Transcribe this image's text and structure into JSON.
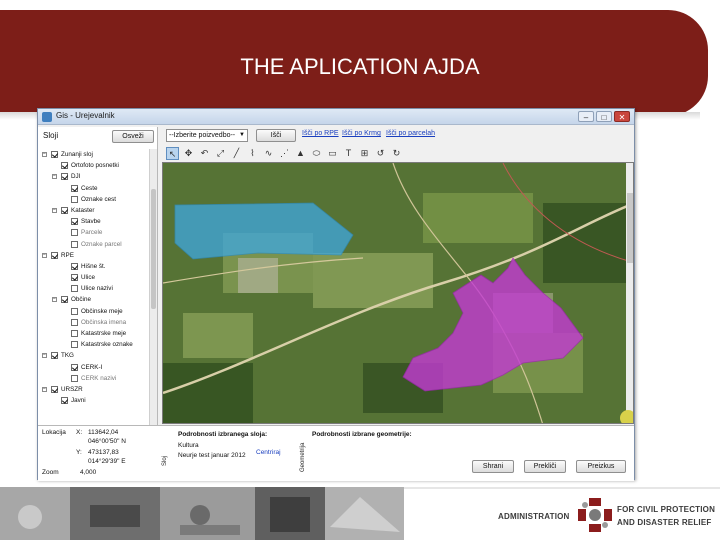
{
  "slide": {
    "title": "THE APLICATION AJDA"
  },
  "window": {
    "title": "Gis - Urejevalnik",
    "minimize": "–",
    "maximize": "□",
    "close": "✕"
  },
  "left_panel": {
    "label": "Sloji",
    "button": "Osveži",
    "tree": [
      {
        "depth": 0,
        "expanded": true,
        "checked": true,
        "label": "Zunanji sloj",
        "dim": false
      },
      {
        "depth": 1,
        "expanded": null,
        "checked": true,
        "label": "Ortofoto posnetki",
        "dim": false
      },
      {
        "depth": 1,
        "expanded": true,
        "checked": true,
        "label": "DJI",
        "dim": false
      },
      {
        "depth": 2,
        "expanded": null,
        "checked": true,
        "label": "Ceste",
        "dim": false
      },
      {
        "depth": 2,
        "expanded": null,
        "checked": false,
        "label": "Oznake cest",
        "dim": false
      },
      {
        "depth": 1,
        "expanded": true,
        "checked": true,
        "label": "Kataster",
        "dim": false
      },
      {
        "depth": 2,
        "expanded": null,
        "checked": true,
        "label": "Stavbe",
        "dim": false
      },
      {
        "depth": 2,
        "expanded": null,
        "checked": false,
        "label": "Parcele",
        "dim": true
      },
      {
        "depth": 2,
        "expanded": null,
        "checked": false,
        "label": "Oznake parcel",
        "dim": true
      },
      {
        "depth": 0,
        "expanded": true,
        "checked": true,
        "label": "RPE",
        "dim": false
      },
      {
        "depth": 2,
        "expanded": null,
        "checked": true,
        "label": "Hišne št.",
        "dim": false
      },
      {
        "depth": 2,
        "expanded": null,
        "checked": true,
        "label": "Ulice",
        "dim": false
      },
      {
        "depth": 2,
        "expanded": null,
        "checked": false,
        "label": "Ulice nazivi",
        "dim": false
      },
      {
        "depth": 1,
        "expanded": true,
        "checked": true,
        "label": "Občine",
        "dim": false
      },
      {
        "depth": 2,
        "expanded": null,
        "checked": false,
        "label": "Občinske meje",
        "dim": false
      },
      {
        "depth": 2,
        "expanded": null,
        "checked": false,
        "label": "Občinska imena",
        "dim": true
      },
      {
        "depth": 2,
        "expanded": null,
        "checked": false,
        "label": "Katastrske meje",
        "dim": false
      },
      {
        "depth": 2,
        "expanded": null,
        "checked": false,
        "label": "Katastrske oznake",
        "dim": false
      },
      {
        "depth": 0,
        "expanded": true,
        "checked": true,
        "label": "TKG",
        "dim": false
      },
      {
        "depth": 2,
        "expanded": null,
        "checked": true,
        "label": "CERK-I",
        "dim": false
      },
      {
        "depth": 2,
        "expanded": null,
        "checked": false,
        "label": "CERK nazivi",
        "dim": true
      },
      {
        "depth": 0,
        "expanded": true,
        "checked": true,
        "label": "URSZR",
        "dim": false
      },
      {
        "depth": 1,
        "expanded": null,
        "checked": true,
        "label": "Javni",
        "dim": false
      }
    ]
  },
  "toolbar": {
    "select_value": "--Izberite poizvedbo--",
    "search_button": "Išči",
    "links": [
      "Išči po RPE",
      "Išči po Krmg",
      "Išči po parcelah"
    ]
  },
  "location": {
    "label": "Lokacija",
    "x_label": "X:",
    "x_value": "113642,04",
    "x_dms": "046°00'50\" N",
    "y_label": "Y:",
    "y_value": "473137,83",
    "y_dms": "014°29'39\" E",
    "zoom_label": "Zoom",
    "zoom_value": "4,000"
  },
  "details": {
    "layer_title": "Podrobnosti izbranega sloja:",
    "geometry_title": "Podrobnosti izbrane geometrije:",
    "tab_left": "Sloj",
    "tab_right": "Geometrija",
    "layer_name": "Kultura",
    "layer_desc": "Neurje test januar 2012",
    "center_link": "Centriraj",
    "buttons": [
      "Shrani",
      "Prekliči",
      "Preizkus"
    ]
  },
  "footer": {
    "administration": "ADMINISTRATION",
    "line1": "FOR CIVIL PROTECTION",
    "line2": "AND DISASTER RELIEF"
  },
  "colors": {
    "header": "#7d1e18",
    "accent_logo": "#8b1c1c",
    "blue_area": "#3fa7e0",
    "magenta_area": "#c33ad3"
  }
}
